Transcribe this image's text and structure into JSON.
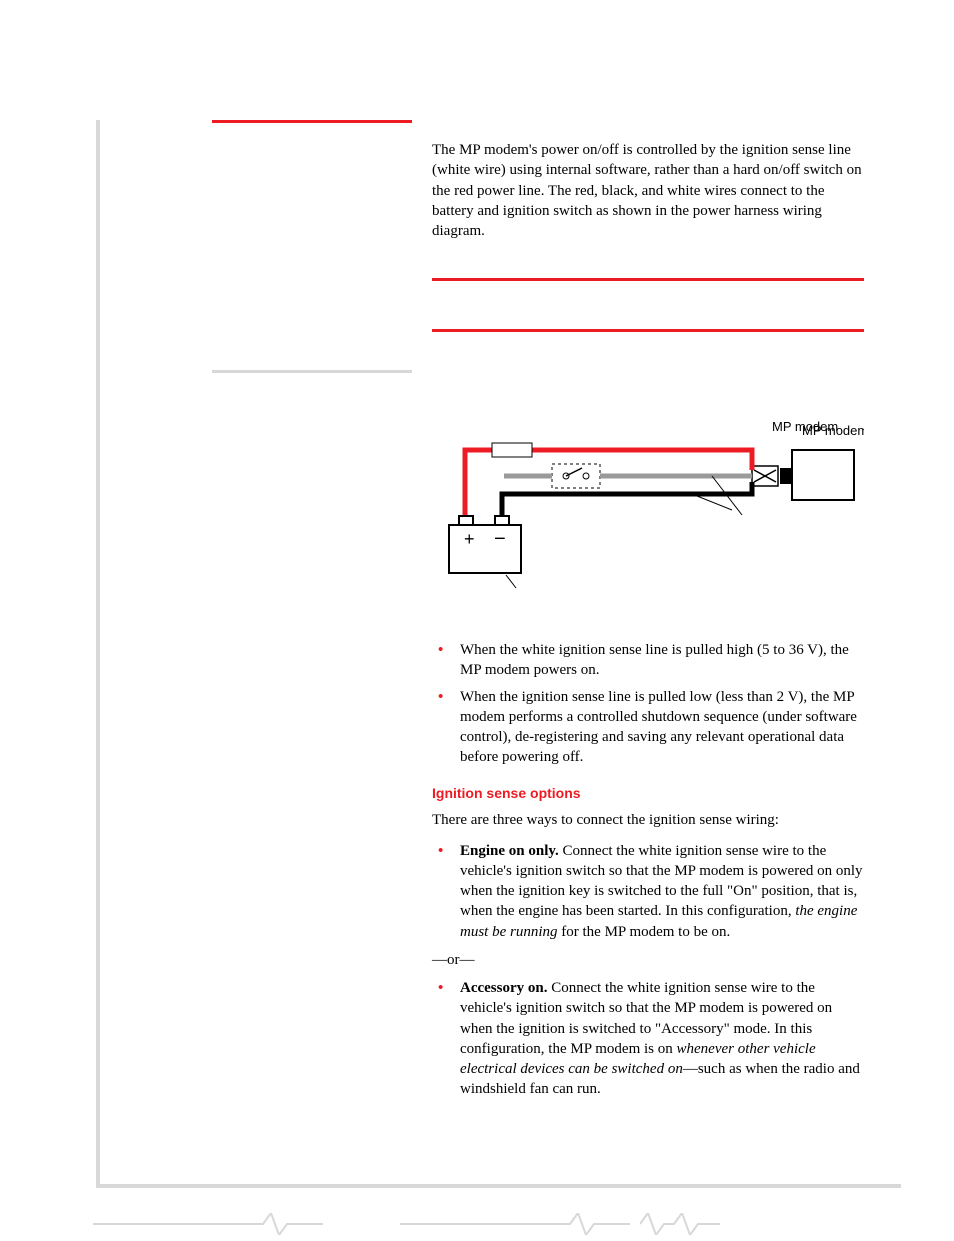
{
  "intro": "The MP modem's power on/off is controlled by the ignition sense line (white wire) using internal software, rather than a hard on/off switch on the red power line. The red, black, and white wires connect to the battery and ignition switch as shown in the power harness wiring diagram.",
  "figure": {
    "label": "MP modem"
  },
  "sense_bullets": [
    "When the white ignition sense line is pulled high (5 to 36 V), the MP modem powers on.",
    "When the ignition sense line is pulled low (less than 2 V), the MP modem performs a controlled shutdown sequence (under software control), de-registering and saving any relevant operational data before powering off."
  ],
  "h_options": "Ignition sense options",
  "options_intro": "There are three ways to connect the ignition sense wiring:",
  "opt1": {
    "lead": "Engine on only.",
    "body": " Connect the white ignition sense wire to the vehicle's ignition switch so that the MP modem is powered on only when the ignition key is switched to the full \"On\" position, that is, when the engine has been started. In this configuration, ",
    "ital": "the engine must be running",
    "tail": " for the MP modem to be on."
  },
  "or": "—or—",
  "opt2": {
    "lead": "Accessory on.",
    "body": " Connect the white ignition sense wire to the vehicle's ignition switch so that the MP modem is powered on when the ignition is switched to \"Accessory\" mode. In this configuration, the MP modem is on ",
    "ital": "whenever other vehicle electrical devices can be switched on",
    "tail": "—such as when the radio and windshield fan can run."
  }
}
